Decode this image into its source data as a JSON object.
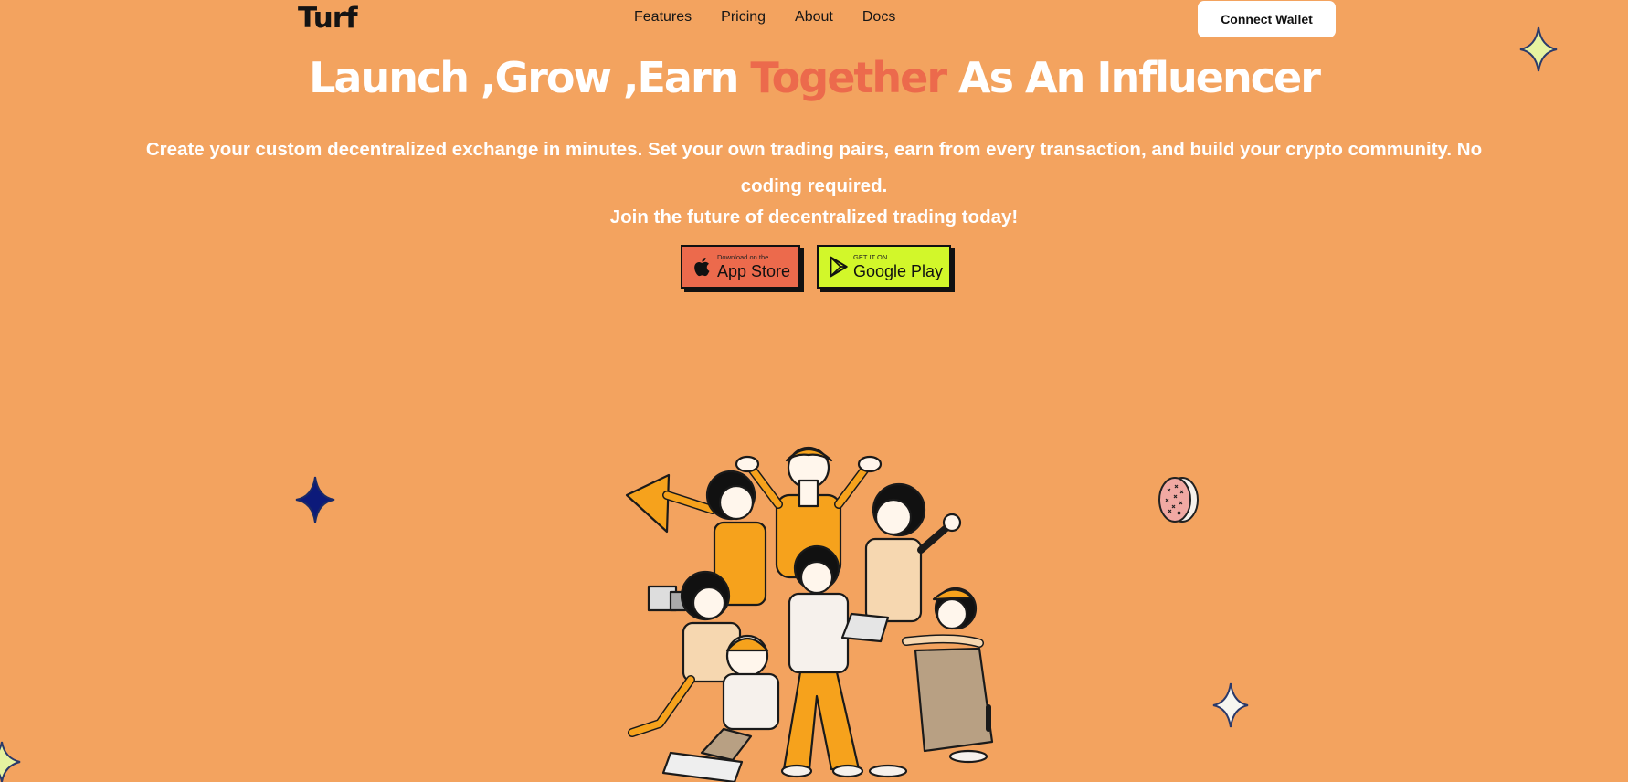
{
  "nav": {
    "logo": "Turf",
    "links": [
      "Features",
      "Pricing",
      "About",
      "Docs"
    ],
    "connect_label": "Connect Wallet"
  },
  "hero": {
    "title_part1": "Launch ,Grow ,Earn ",
    "title_accent": "Together",
    "title_part2": " As An Influencer",
    "subtitle": "Create your custom decentralized exchange in minutes. Set your own trading pairs, earn from every transaction, and build your crypto community. No coding required.",
    "join": "Join the future of decentralized trading today!"
  },
  "stores": {
    "appstore_small": "Download on the",
    "appstore_big": "App Store",
    "gplay_small": "GET IT ON",
    "gplay_big": "Google Play"
  },
  "colors": {
    "background": "#f3a35f",
    "accent": "#ec6a4c",
    "gplay": "#d2f72a",
    "star_light": "#e6f3a0",
    "star_dark": "#0c1a7a"
  },
  "icons": [
    "apple-icon",
    "play-icon",
    "sparkle-icon",
    "coin-icon"
  ]
}
